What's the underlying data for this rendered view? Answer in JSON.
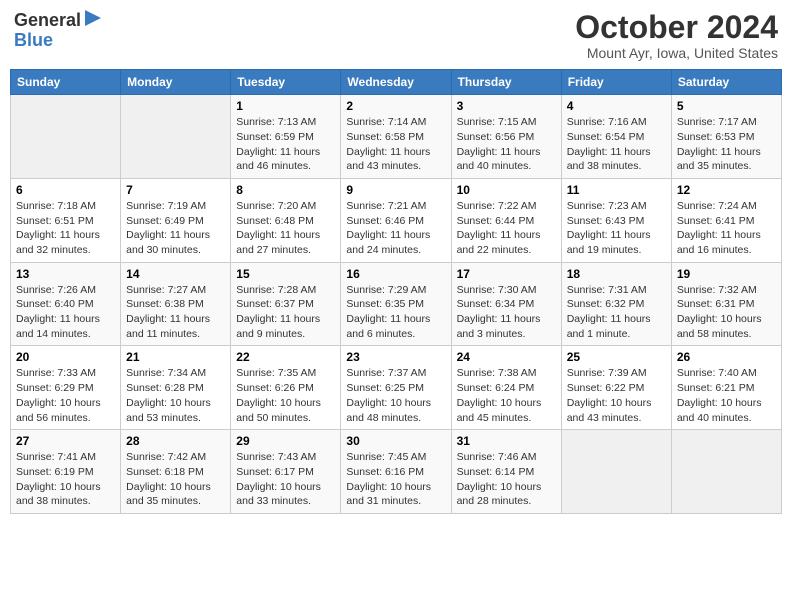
{
  "header": {
    "logo_general": "General",
    "logo_blue": "Blue",
    "month_title": "October 2024",
    "location": "Mount Ayr, Iowa, United States"
  },
  "weekdays": [
    "Sunday",
    "Monday",
    "Tuesday",
    "Wednesday",
    "Thursday",
    "Friday",
    "Saturday"
  ],
  "weeks": [
    [
      {
        "day": "",
        "info": ""
      },
      {
        "day": "",
        "info": ""
      },
      {
        "day": "1",
        "info": "Sunrise: 7:13 AM\nSunset: 6:59 PM\nDaylight: 11 hours and 46 minutes."
      },
      {
        "day": "2",
        "info": "Sunrise: 7:14 AM\nSunset: 6:58 PM\nDaylight: 11 hours and 43 minutes."
      },
      {
        "day": "3",
        "info": "Sunrise: 7:15 AM\nSunset: 6:56 PM\nDaylight: 11 hours and 40 minutes."
      },
      {
        "day": "4",
        "info": "Sunrise: 7:16 AM\nSunset: 6:54 PM\nDaylight: 11 hours and 38 minutes."
      },
      {
        "day": "5",
        "info": "Sunrise: 7:17 AM\nSunset: 6:53 PM\nDaylight: 11 hours and 35 minutes."
      }
    ],
    [
      {
        "day": "6",
        "info": "Sunrise: 7:18 AM\nSunset: 6:51 PM\nDaylight: 11 hours and 32 minutes."
      },
      {
        "day": "7",
        "info": "Sunrise: 7:19 AM\nSunset: 6:49 PM\nDaylight: 11 hours and 30 minutes."
      },
      {
        "day": "8",
        "info": "Sunrise: 7:20 AM\nSunset: 6:48 PM\nDaylight: 11 hours and 27 minutes."
      },
      {
        "day": "9",
        "info": "Sunrise: 7:21 AM\nSunset: 6:46 PM\nDaylight: 11 hours and 24 minutes."
      },
      {
        "day": "10",
        "info": "Sunrise: 7:22 AM\nSunset: 6:44 PM\nDaylight: 11 hours and 22 minutes."
      },
      {
        "day": "11",
        "info": "Sunrise: 7:23 AM\nSunset: 6:43 PM\nDaylight: 11 hours and 19 minutes."
      },
      {
        "day": "12",
        "info": "Sunrise: 7:24 AM\nSunset: 6:41 PM\nDaylight: 11 hours and 16 minutes."
      }
    ],
    [
      {
        "day": "13",
        "info": "Sunrise: 7:26 AM\nSunset: 6:40 PM\nDaylight: 11 hours and 14 minutes."
      },
      {
        "day": "14",
        "info": "Sunrise: 7:27 AM\nSunset: 6:38 PM\nDaylight: 11 hours and 11 minutes."
      },
      {
        "day": "15",
        "info": "Sunrise: 7:28 AM\nSunset: 6:37 PM\nDaylight: 11 hours and 9 minutes."
      },
      {
        "day": "16",
        "info": "Sunrise: 7:29 AM\nSunset: 6:35 PM\nDaylight: 11 hours and 6 minutes."
      },
      {
        "day": "17",
        "info": "Sunrise: 7:30 AM\nSunset: 6:34 PM\nDaylight: 11 hours and 3 minutes."
      },
      {
        "day": "18",
        "info": "Sunrise: 7:31 AM\nSunset: 6:32 PM\nDaylight: 11 hours and 1 minute."
      },
      {
        "day": "19",
        "info": "Sunrise: 7:32 AM\nSunset: 6:31 PM\nDaylight: 10 hours and 58 minutes."
      }
    ],
    [
      {
        "day": "20",
        "info": "Sunrise: 7:33 AM\nSunset: 6:29 PM\nDaylight: 10 hours and 56 minutes."
      },
      {
        "day": "21",
        "info": "Sunrise: 7:34 AM\nSunset: 6:28 PM\nDaylight: 10 hours and 53 minutes."
      },
      {
        "day": "22",
        "info": "Sunrise: 7:35 AM\nSunset: 6:26 PM\nDaylight: 10 hours and 50 minutes."
      },
      {
        "day": "23",
        "info": "Sunrise: 7:37 AM\nSunset: 6:25 PM\nDaylight: 10 hours and 48 minutes."
      },
      {
        "day": "24",
        "info": "Sunrise: 7:38 AM\nSunset: 6:24 PM\nDaylight: 10 hours and 45 minutes."
      },
      {
        "day": "25",
        "info": "Sunrise: 7:39 AM\nSunset: 6:22 PM\nDaylight: 10 hours and 43 minutes."
      },
      {
        "day": "26",
        "info": "Sunrise: 7:40 AM\nSunset: 6:21 PM\nDaylight: 10 hours and 40 minutes."
      }
    ],
    [
      {
        "day": "27",
        "info": "Sunrise: 7:41 AM\nSunset: 6:19 PM\nDaylight: 10 hours and 38 minutes."
      },
      {
        "day": "28",
        "info": "Sunrise: 7:42 AM\nSunset: 6:18 PM\nDaylight: 10 hours and 35 minutes."
      },
      {
        "day": "29",
        "info": "Sunrise: 7:43 AM\nSunset: 6:17 PM\nDaylight: 10 hours and 33 minutes."
      },
      {
        "day": "30",
        "info": "Sunrise: 7:45 AM\nSunset: 6:16 PM\nDaylight: 10 hours and 31 minutes."
      },
      {
        "day": "31",
        "info": "Sunrise: 7:46 AM\nSunset: 6:14 PM\nDaylight: 10 hours and 28 minutes."
      },
      {
        "day": "",
        "info": ""
      },
      {
        "day": "",
        "info": ""
      }
    ]
  ]
}
